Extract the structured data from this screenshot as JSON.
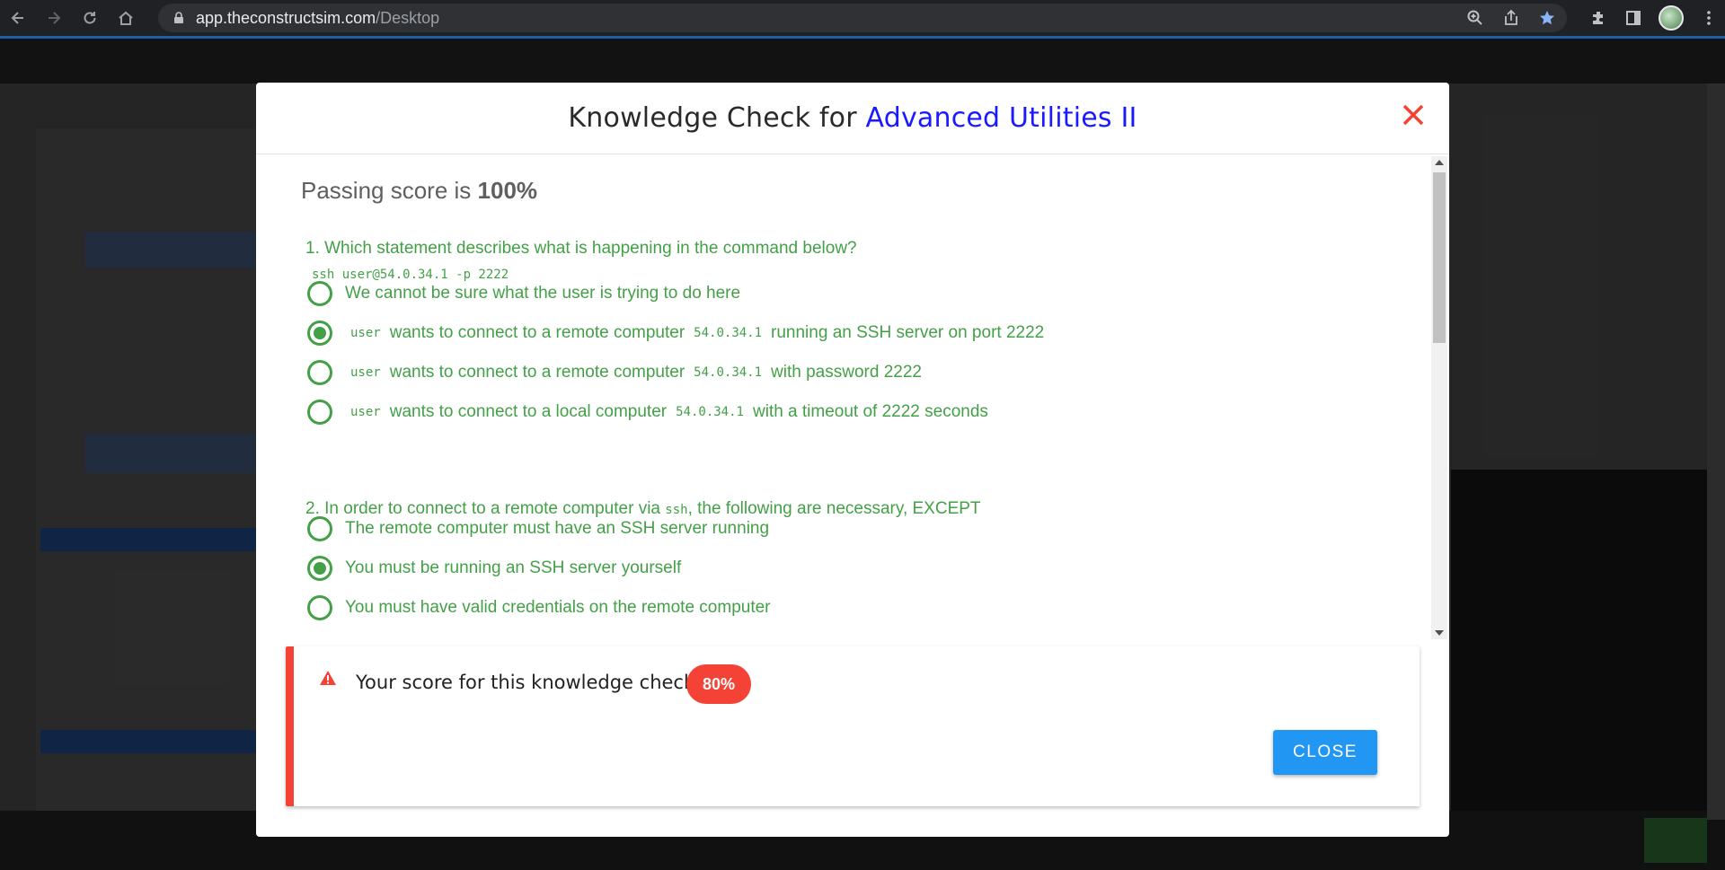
{
  "browser": {
    "url_host": "app.theconstructsim.com",
    "url_path": "/Desktop"
  },
  "modal": {
    "title_prefix": "Knowledge Check for",
    "course_name": "Advanced Utilities II",
    "passing_label": "Passing score is",
    "passing_value": "100%",
    "questions": [
      {
        "text": "1. Which statement describes what is happening in the command below?",
        "command": "ssh user@54.0.34.1 -p 2222",
        "options": [
          {
            "text": "We cannot be sure what the user is trying to do here",
            "selected": false
          },
          {
            "code1": "user",
            "text1": "wants to connect to a remote computer",
            "code2": "54.0.34.1",
            "text2": "running an SSH server on port 2222",
            "selected": true
          },
          {
            "code1": "user",
            "text1": "wants to connect to a remote computer",
            "code2": "54.0.34.1",
            "text2": "with password 2222",
            "selected": false
          },
          {
            "code1": "user",
            "text1": "wants to connect to a local computer",
            "code2": "54.0.34.1",
            "text2": "with a timeout of 2222 seconds",
            "selected": false
          }
        ]
      },
      {
        "text_before": "2. In order to connect to a remote computer via",
        "code": "ssh",
        "text_after": ", the following are necessary, EXCEPT",
        "options": [
          {
            "text": "The remote computer must have an SSH server running",
            "selected": false
          },
          {
            "text": "You must be running an SSH server yourself",
            "selected": true
          },
          {
            "text": "You must have valid credentials on the remote computer",
            "selected": false
          }
        ]
      }
    ],
    "score_label": "Your score for this knowledge check:",
    "score_value": "80%",
    "close_label": "CLOSE"
  },
  "colors": {
    "accent_green": "#43a047",
    "title_blue": "#1a1aff",
    "error_red": "#f44336",
    "button_blue": "#2196f3"
  }
}
